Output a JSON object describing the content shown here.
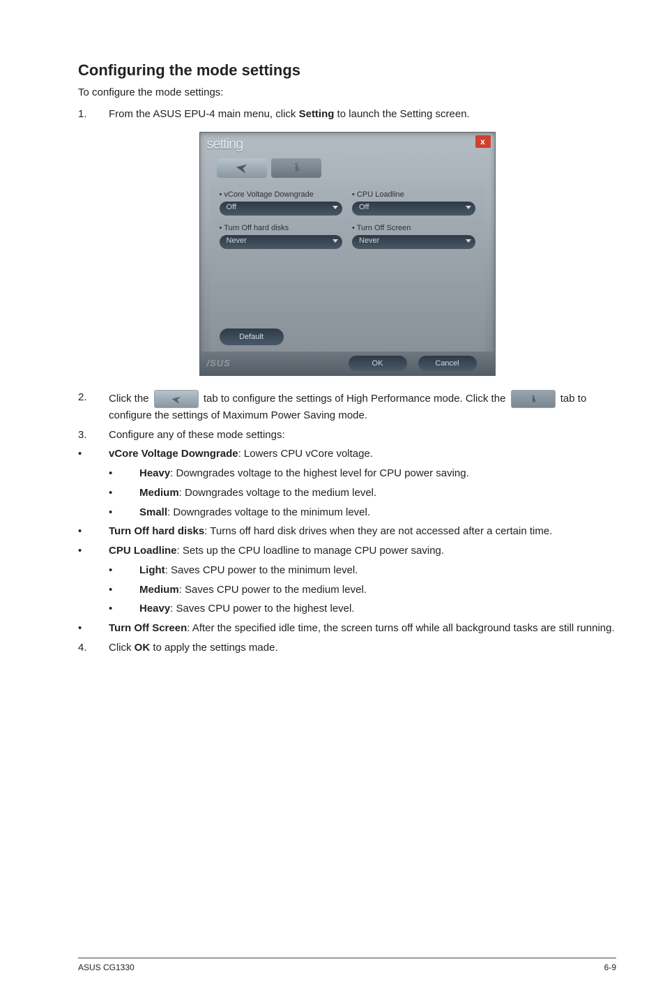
{
  "heading": "Configuring the mode settings",
  "intro": "To configure the mode settings:",
  "step1_num": "1.",
  "step1_a": "From the ASUS EPU-4 main menu, click ",
  "step1_b": "Setting",
  "step1_c": "  to launch the Setting screen.",
  "dialog": {
    "title": "setting",
    "close": "x",
    "vcore_label": "vCore Voltage Downgrade",
    "vcore_value": "Off",
    "cpu_label": "CPU Loadline",
    "cpu_value": "Off",
    "hdd_label": "Turn Off hard disks",
    "hdd_value": "Never",
    "screen_label": "Turn Off Screen",
    "screen_value": "Never",
    "default_btn": "Default",
    "ok_btn": "OK",
    "cancel_btn": "Cancel",
    "logo": "/SUS"
  },
  "step2_num": "2.",
  "step2_a": "Click the ",
  "step2_b": " tab to configure the settings of High Performance mode. Click the ",
  "step2_c": " tab to configure the settings of Maximum Power Saving mode.",
  "step3_num": "3.",
  "step3": "Configure any of these mode settings:",
  "bul": "•",
  "vcore_t": "vCore Voltage Downgrade",
  "vcore_d": ": Lowers CPU vCore voltage.",
  "heavy_t": "Heavy",
  "heavy_d": ": Downgrades voltage to the highest level for CPU power saving.",
  "medium_t": "Medium",
  "medium_d": ": Downgrades voltage to the medium level.",
  "small_t": "Small",
  "small_d": ": Downgrades voltage to the minimum level.",
  "hdd_t": "Turn Off hard disks",
  "hdd_d": ": Turns off hard disk drives when they are not accessed after a certain time.",
  "cpu_t": "CPU Loadline",
  "cpu_d": ": Sets up the CPU loadline to manage CPU power saving.",
  "light_t": "Light",
  "light_d": ": Saves CPU power to the minimum level.",
  "med2_t": "Medium",
  "med2_d": ": Saves CPU power to the medium level.",
  "heavy2_t": "Heavy",
  "heavy2_d": ": Saves CPU power to the highest level.",
  "screen_t": "Turn Off Screen",
  "screen_d": ": After the specified idle time, the screen turns off while all background tasks are still running.",
  "step4_num": "4.",
  "step4_a": "Click ",
  "step4_b": "OK",
  "step4_c": " to apply the settings made.",
  "footer_left": "ASUS CG1330",
  "footer_right": "6-9"
}
